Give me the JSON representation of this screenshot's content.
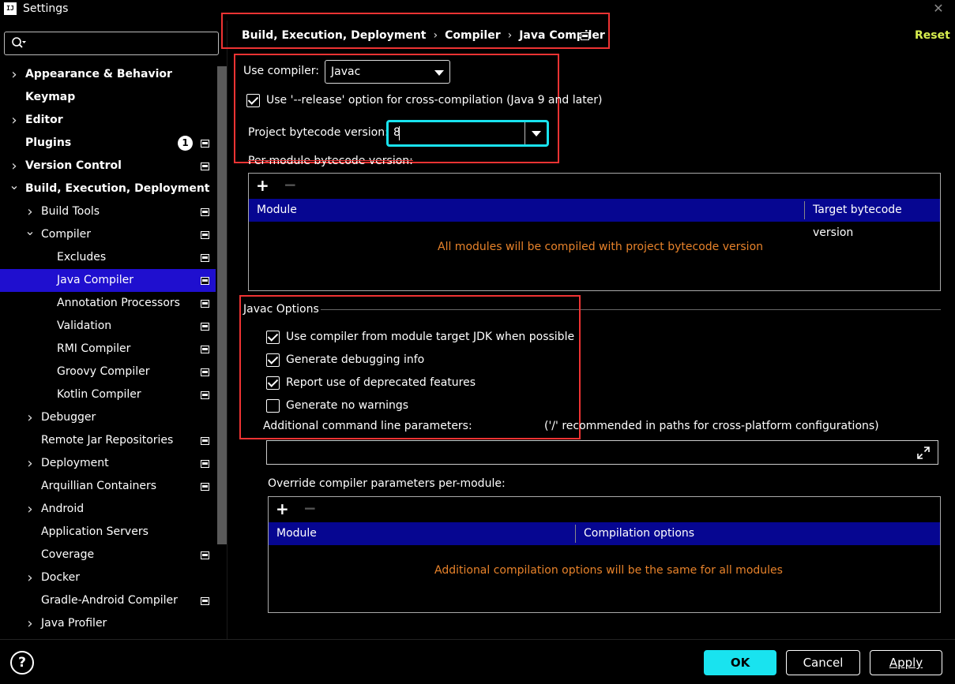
{
  "window": {
    "title": "Settings",
    "app_icon_text": "IJ",
    "close_icon": "close-icon"
  },
  "search": {
    "placeholder": ""
  },
  "sidebar": {
    "items": [
      {
        "label": "Appearance & Behavior",
        "bold": true,
        "chevron": "right",
        "indent": 0,
        "has_icon": false
      },
      {
        "label": "Keymap",
        "bold": true,
        "chevron": "",
        "indent": 0,
        "has_icon": false
      },
      {
        "label": "Editor",
        "bold": true,
        "chevron": "right",
        "indent": 0,
        "has_icon": false
      },
      {
        "label": "Plugins",
        "bold": true,
        "chevron": "",
        "indent": 0,
        "has_icon": true,
        "badge": "1"
      },
      {
        "label": "Version Control",
        "bold": true,
        "chevron": "right",
        "indent": 0,
        "has_icon": true
      },
      {
        "label": "Build, Execution, Deployment",
        "bold": true,
        "chevron": "down",
        "indent": 0,
        "has_icon": false
      },
      {
        "label": "Build Tools",
        "bold": false,
        "chevron": "right",
        "indent": 1,
        "has_icon": true
      },
      {
        "label": "Compiler",
        "bold": false,
        "chevron": "down",
        "indent": 1,
        "has_icon": true
      },
      {
        "label": "Excludes",
        "bold": false,
        "chevron": "",
        "indent": 2,
        "has_icon": true
      },
      {
        "label": "Java Compiler",
        "bold": false,
        "chevron": "",
        "indent": 2,
        "has_icon": true,
        "selected": true
      },
      {
        "label": "Annotation Processors",
        "bold": false,
        "chevron": "",
        "indent": 2,
        "has_icon": true
      },
      {
        "label": "Validation",
        "bold": false,
        "chevron": "",
        "indent": 2,
        "has_icon": true
      },
      {
        "label": "RMI Compiler",
        "bold": false,
        "chevron": "",
        "indent": 2,
        "has_icon": true
      },
      {
        "label": "Groovy Compiler",
        "bold": false,
        "chevron": "",
        "indent": 2,
        "has_icon": true
      },
      {
        "label": "Kotlin Compiler",
        "bold": false,
        "chevron": "",
        "indent": 2,
        "has_icon": true
      },
      {
        "label": "Debugger",
        "bold": false,
        "chevron": "right",
        "indent": 1,
        "has_icon": false
      },
      {
        "label": "Remote Jar Repositories",
        "bold": false,
        "chevron": "",
        "indent": 1,
        "has_icon": true
      },
      {
        "label": "Deployment",
        "bold": false,
        "chevron": "right",
        "indent": 1,
        "has_icon": true
      },
      {
        "label": "Arquillian Containers",
        "bold": false,
        "chevron": "",
        "indent": 1,
        "has_icon": true
      },
      {
        "label": "Android",
        "bold": false,
        "chevron": "right",
        "indent": 1,
        "has_icon": false
      },
      {
        "label": "Application Servers",
        "bold": false,
        "chevron": "",
        "indent": 1,
        "has_icon": false
      },
      {
        "label": "Coverage",
        "bold": false,
        "chevron": "",
        "indent": 1,
        "has_icon": true
      },
      {
        "label": "Docker",
        "bold": false,
        "chevron": "right",
        "indent": 1,
        "has_icon": false
      },
      {
        "label": "Gradle-Android Compiler",
        "bold": false,
        "chevron": "",
        "indent": 1,
        "has_icon": true
      },
      {
        "label": "Java Profiler",
        "bold": false,
        "chevron": "right",
        "indent": 1,
        "has_icon": false
      }
    ]
  },
  "header": {
    "breadcrumb": [
      "Build, Execution, Deployment",
      "Compiler",
      "Java Compiler"
    ],
    "reset_label": "Reset"
  },
  "compiler": {
    "use_compiler_label": "Use compiler:",
    "use_compiler_value": "Javac",
    "release_option_label": "Use '--release' option for cross-compilation (Java 9 and later)",
    "release_option_checked": true,
    "bytecode_label": "Project bytecode version:",
    "bytecode_value": "8",
    "per_module_label": "Per-module bytecode version:",
    "per_module_table": {
      "columns": [
        "Module",
        "Target bytecode version"
      ],
      "empty_text": "All modules will be compiled with project bytecode version"
    }
  },
  "javac": {
    "section_title": "Javac Options",
    "options": [
      {
        "label": "Use compiler from module target JDK when possible",
        "checked": true
      },
      {
        "label": "Generate debugging info",
        "checked": true
      },
      {
        "label": "Report use of deprecated features",
        "checked": true
      },
      {
        "label": "Generate no warnings",
        "checked": false
      }
    ],
    "cmdline_label": "Additional command line parameters:",
    "cmdline_hint": "('/' recommended in paths for cross-platform configurations)",
    "cmdline_value": "",
    "override_label": "Override compiler parameters per-module:",
    "override_table": {
      "columns": [
        "Module",
        "Compilation options"
      ],
      "empty_text": "Additional compilation options will be the same for all modules"
    }
  },
  "footer": {
    "help_label": "?",
    "ok_label": "OK",
    "cancel_label": "Cancel",
    "apply_label": "Apply"
  },
  "colors": {
    "accent": "#19e3ef",
    "selection": "#1f0fcf",
    "table_header": "#060691",
    "warning_text": "#e7822a",
    "reset": "#d8ef4f",
    "highlight_box": "#e33333"
  }
}
